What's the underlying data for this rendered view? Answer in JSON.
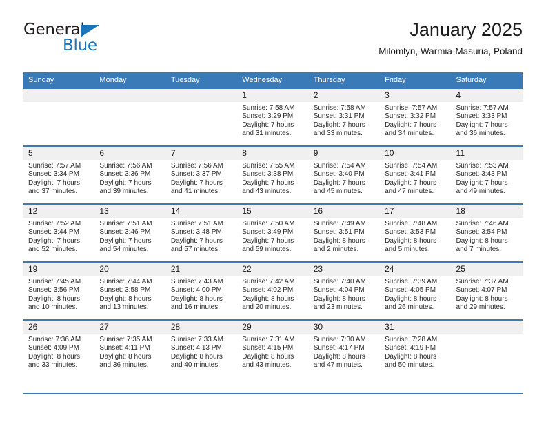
{
  "brand": {
    "name_top": "General",
    "name_bottom": "Blue",
    "triangle_icon": "triangle-icon",
    "accent_color": "#1b75bb"
  },
  "header": {
    "title": "January 2025",
    "subtitle": "Milomlyn, Warmia-Masuria, Poland"
  },
  "theme": {
    "header_blue": "#3a7ab8",
    "daynum_band": "#f0f0f0",
    "text": "#1a1a1a"
  },
  "weekday_headers": [
    "Sunday",
    "Monday",
    "Tuesday",
    "Wednesday",
    "Thursday",
    "Friday",
    "Saturday"
  ],
  "labels": {
    "sunrise_prefix": "Sunrise: ",
    "sunset_prefix": "Sunset: ",
    "daylight_prefix": "Daylight: "
  },
  "weeks": [
    [
      {
        "day": "",
        "empty": true,
        "sunrise": "",
        "sunset": "",
        "daylight_line1": "",
        "daylight_line2": ""
      },
      {
        "day": "",
        "empty": true,
        "sunrise": "",
        "sunset": "",
        "daylight_line1": "",
        "daylight_line2": ""
      },
      {
        "day": "",
        "empty": true,
        "sunrise": "",
        "sunset": "",
        "daylight_line1": "",
        "daylight_line2": ""
      },
      {
        "day": "1",
        "empty": false,
        "sunrise": "Sunrise: 7:58 AM",
        "sunset": "Sunset: 3:29 PM",
        "daylight_line1": "Daylight: 7 hours",
        "daylight_line2": "and 31 minutes."
      },
      {
        "day": "2",
        "empty": false,
        "sunrise": "Sunrise: 7:58 AM",
        "sunset": "Sunset: 3:31 PM",
        "daylight_line1": "Daylight: 7 hours",
        "daylight_line2": "and 33 minutes."
      },
      {
        "day": "3",
        "empty": false,
        "sunrise": "Sunrise: 7:57 AM",
        "sunset": "Sunset: 3:32 PM",
        "daylight_line1": "Daylight: 7 hours",
        "daylight_line2": "and 34 minutes."
      },
      {
        "day": "4",
        "empty": false,
        "sunrise": "Sunrise: 7:57 AM",
        "sunset": "Sunset: 3:33 PM",
        "daylight_line1": "Daylight: 7 hours",
        "daylight_line2": "and 36 minutes."
      }
    ],
    [
      {
        "day": "5",
        "empty": false,
        "sunrise": "Sunrise: 7:57 AM",
        "sunset": "Sunset: 3:34 PM",
        "daylight_line1": "Daylight: 7 hours",
        "daylight_line2": "and 37 minutes."
      },
      {
        "day": "6",
        "empty": false,
        "sunrise": "Sunrise: 7:56 AM",
        "sunset": "Sunset: 3:36 PM",
        "daylight_line1": "Daylight: 7 hours",
        "daylight_line2": "and 39 minutes."
      },
      {
        "day": "7",
        "empty": false,
        "sunrise": "Sunrise: 7:56 AM",
        "sunset": "Sunset: 3:37 PM",
        "daylight_line1": "Daylight: 7 hours",
        "daylight_line2": "and 41 minutes."
      },
      {
        "day": "8",
        "empty": false,
        "sunrise": "Sunrise: 7:55 AM",
        "sunset": "Sunset: 3:38 PM",
        "daylight_line1": "Daylight: 7 hours",
        "daylight_line2": "and 43 minutes."
      },
      {
        "day": "9",
        "empty": false,
        "sunrise": "Sunrise: 7:54 AM",
        "sunset": "Sunset: 3:40 PM",
        "daylight_line1": "Daylight: 7 hours",
        "daylight_line2": "and 45 minutes."
      },
      {
        "day": "10",
        "empty": false,
        "sunrise": "Sunrise: 7:54 AM",
        "sunset": "Sunset: 3:41 PM",
        "daylight_line1": "Daylight: 7 hours",
        "daylight_line2": "and 47 minutes."
      },
      {
        "day": "11",
        "empty": false,
        "sunrise": "Sunrise: 7:53 AM",
        "sunset": "Sunset: 3:43 PM",
        "daylight_line1": "Daylight: 7 hours",
        "daylight_line2": "and 49 minutes."
      }
    ],
    [
      {
        "day": "12",
        "empty": false,
        "sunrise": "Sunrise: 7:52 AM",
        "sunset": "Sunset: 3:44 PM",
        "daylight_line1": "Daylight: 7 hours",
        "daylight_line2": "and 52 minutes."
      },
      {
        "day": "13",
        "empty": false,
        "sunrise": "Sunrise: 7:51 AM",
        "sunset": "Sunset: 3:46 PM",
        "daylight_line1": "Daylight: 7 hours",
        "daylight_line2": "and 54 minutes."
      },
      {
        "day": "14",
        "empty": false,
        "sunrise": "Sunrise: 7:51 AM",
        "sunset": "Sunset: 3:48 PM",
        "daylight_line1": "Daylight: 7 hours",
        "daylight_line2": "and 57 minutes."
      },
      {
        "day": "15",
        "empty": false,
        "sunrise": "Sunrise: 7:50 AM",
        "sunset": "Sunset: 3:49 PM",
        "daylight_line1": "Daylight: 7 hours",
        "daylight_line2": "and 59 minutes."
      },
      {
        "day": "16",
        "empty": false,
        "sunrise": "Sunrise: 7:49 AM",
        "sunset": "Sunset: 3:51 PM",
        "daylight_line1": "Daylight: 8 hours",
        "daylight_line2": "and 2 minutes."
      },
      {
        "day": "17",
        "empty": false,
        "sunrise": "Sunrise: 7:48 AM",
        "sunset": "Sunset: 3:53 PM",
        "daylight_line1": "Daylight: 8 hours",
        "daylight_line2": "and 5 minutes."
      },
      {
        "day": "18",
        "empty": false,
        "sunrise": "Sunrise: 7:46 AM",
        "sunset": "Sunset: 3:54 PM",
        "daylight_line1": "Daylight: 8 hours",
        "daylight_line2": "and 7 minutes."
      }
    ],
    [
      {
        "day": "19",
        "empty": false,
        "sunrise": "Sunrise: 7:45 AM",
        "sunset": "Sunset: 3:56 PM",
        "daylight_line1": "Daylight: 8 hours",
        "daylight_line2": "and 10 minutes."
      },
      {
        "day": "20",
        "empty": false,
        "sunrise": "Sunrise: 7:44 AM",
        "sunset": "Sunset: 3:58 PM",
        "daylight_line1": "Daylight: 8 hours",
        "daylight_line2": "and 13 minutes."
      },
      {
        "day": "21",
        "empty": false,
        "sunrise": "Sunrise: 7:43 AM",
        "sunset": "Sunset: 4:00 PM",
        "daylight_line1": "Daylight: 8 hours",
        "daylight_line2": "and 16 minutes."
      },
      {
        "day": "22",
        "empty": false,
        "sunrise": "Sunrise: 7:42 AM",
        "sunset": "Sunset: 4:02 PM",
        "daylight_line1": "Daylight: 8 hours",
        "daylight_line2": "and 20 minutes."
      },
      {
        "day": "23",
        "empty": false,
        "sunrise": "Sunrise: 7:40 AM",
        "sunset": "Sunset: 4:04 PM",
        "daylight_line1": "Daylight: 8 hours",
        "daylight_line2": "and 23 minutes."
      },
      {
        "day": "24",
        "empty": false,
        "sunrise": "Sunrise: 7:39 AM",
        "sunset": "Sunset: 4:05 PM",
        "daylight_line1": "Daylight: 8 hours",
        "daylight_line2": "and 26 minutes."
      },
      {
        "day": "25",
        "empty": false,
        "sunrise": "Sunrise: 7:37 AM",
        "sunset": "Sunset: 4:07 PM",
        "daylight_line1": "Daylight: 8 hours",
        "daylight_line2": "and 29 minutes."
      }
    ],
    [
      {
        "day": "26",
        "empty": false,
        "sunrise": "Sunrise: 7:36 AM",
        "sunset": "Sunset: 4:09 PM",
        "daylight_line1": "Daylight: 8 hours",
        "daylight_line2": "and 33 minutes."
      },
      {
        "day": "27",
        "empty": false,
        "sunrise": "Sunrise: 7:35 AM",
        "sunset": "Sunset: 4:11 PM",
        "daylight_line1": "Daylight: 8 hours",
        "daylight_line2": "and 36 minutes."
      },
      {
        "day": "28",
        "empty": false,
        "sunrise": "Sunrise: 7:33 AM",
        "sunset": "Sunset: 4:13 PM",
        "daylight_line1": "Daylight: 8 hours",
        "daylight_line2": "and 40 minutes."
      },
      {
        "day": "29",
        "empty": false,
        "sunrise": "Sunrise: 7:31 AM",
        "sunset": "Sunset: 4:15 PM",
        "daylight_line1": "Daylight: 8 hours",
        "daylight_line2": "and 43 minutes."
      },
      {
        "day": "30",
        "empty": false,
        "sunrise": "Sunrise: 7:30 AM",
        "sunset": "Sunset: 4:17 PM",
        "daylight_line1": "Daylight: 8 hours",
        "daylight_line2": "and 47 minutes."
      },
      {
        "day": "31",
        "empty": false,
        "sunrise": "Sunrise: 7:28 AM",
        "sunset": "Sunset: 4:19 PM",
        "daylight_line1": "Daylight: 8 hours",
        "daylight_line2": "and 50 minutes."
      },
      {
        "day": "",
        "empty": true,
        "sunrise": "",
        "sunset": "",
        "daylight_line1": "",
        "daylight_line2": ""
      }
    ]
  ]
}
